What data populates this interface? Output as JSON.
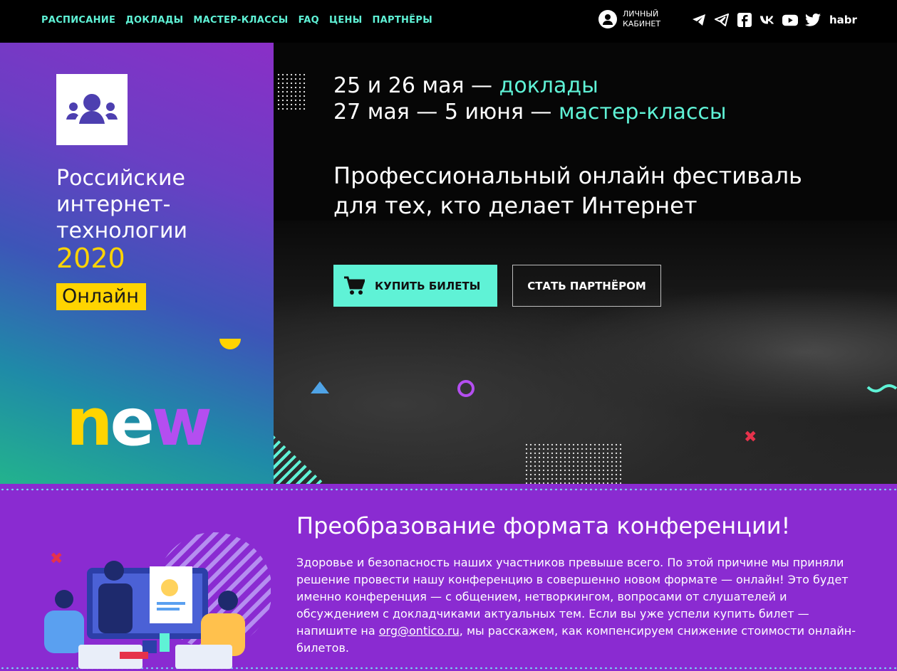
{
  "nav": {
    "links": [
      "РАСПИСАНИЕ",
      "ДОКЛАДЫ",
      "МАСТЕР-КЛАССЫ",
      "FAQ",
      "ЦЕНЫ",
      "ПАРТНЁРЫ"
    ],
    "cabinet_line1": "ЛИЧНЫЙ",
    "cabinet_line2": "КАБИНЕТ",
    "socials": [
      "telegram-icon",
      "telegram-channel-icon",
      "facebook-icon",
      "vk-icon",
      "youtube-icon",
      "twitter-icon"
    ],
    "habr": "habr"
  },
  "left": {
    "title_line1": "Российские",
    "title_line2": "интернет-",
    "title_line3": "технологии",
    "year": "2020",
    "badge": "Онлайн",
    "new_n": "n",
    "new_e": "e",
    "new_w": "w"
  },
  "hero": {
    "date1_prefix": "25 и 26 мая — ",
    "date1_highlight": "доклады",
    "date2_prefix": "27 мая — 5 июня — ",
    "date2_highlight": "мастер-классы",
    "tagline_line1": "Профессиональный онлайн фестиваль",
    "tagline_line2": "для тех, кто делает Интернет",
    "buy_button": "КУПИТЬ БИЛЕТЫ",
    "partner_button": "СТАТЬ ПАРТНЁРОМ"
  },
  "bottom": {
    "title": "Преобразование формата конференции!",
    "text_before_link": "Здоровье и безопасность наших участников превыше всего. По этой причине мы приняли решение провести нашу конференцию в совершенно новом формате — онлайн! Это будет именно конференция — с общением, нетворкингом, вопросами от слушателей и обсуждением с докладчиками актуальных тем. Если вы уже успели купить билет — напишите на ",
    "email": "org@ontico.ru",
    "text_after_link": ", мы расскажем, как компенсируем снижение стоимости онлайн-билетов."
  },
  "colors": {
    "accent": "#5ff2d6",
    "yellow": "#ffd400",
    "purple": "#8a2bd1"
  }
}
